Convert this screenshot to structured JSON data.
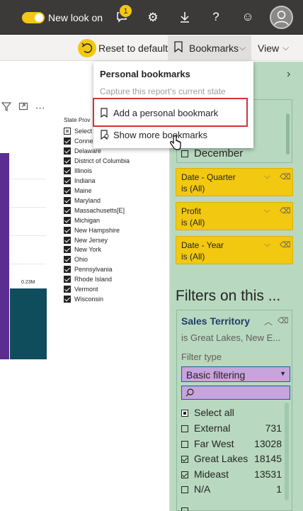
{
  "topbar": {
    "new_look_label": "New look on",
    "notification_count": "1",
    "icons": [
      "notification-icon",
      "gear-icon",
      "download-icon",
      "help-icon",
      "smiley-icon",
      "avatar-icon"
    ]
  },
  "toolbar": {
    "reset_label": "Reset to default",
    "bookmarks_label": "Bookmarks",
    "view_label": "View"
  },
  "bookmarks_menu": {
    "header": "Personal bookmarks",
    "subtitle": "Capture this report's current state",
    "add_label": "Add a personal bookmark",
    "show_more_label": "Show more bookmarks"
  },
  "slicer": {
    "title": "State Prov",
    "select_all": "Select",
    "items": [
      "Conne",
      "Delaware",
      "District of Columbia",
      "Illinois",
      "Indiana",
      "Maine",
      "Maryland",
      "Massachusetts[E]",
      "Michigan",
      "New Hampshire",
      "New Jersey",
      "New York",
      "Ohio",
      "Pennsylvania",
      "Rhode Island",
      "Vermont",
      "Wisconsin"
    ]
  },
  "chart": {
    "bar_label": "0.23M"
  },
  "filters": {
    "top_item": "December",
    "cards": [
      {
        "title": "Date - Quarter",
        "value": "is (All)"
      },
      {
        "title": "Profit",
        "value": "is (All)"
      },
      {
        "title": "Date - Year",
        "value": "is (All)"
      }
    ],
    "section_title": "Filters on this ...",
    "sales": {
      "title": "Sales Territory",
      "summary": "is Great Lakes, New E...",
      "filter_type_label": "Filter type",
      "filter_type_value": "Basic filtering",
      "select_all": "Select all",
      "items": [
        {
          "name": "External",
          "count": "731",
          "checked": false
        },
        {
          "name": "Far West",
          "count": "13028",
          "checked": false
        },
        {
          "name": "Great Lakes",
          "count": "18145",
          "checked": true
        },
        {
          "name": "Mideast",
          "count": "13531",
          "checked": true
        },
        {
          "name": "N/A",
          "count": "1",
          "checked": false
        }
      ]
    }
  },
  "colors": {
    "topbar": "#3b3a39",
    "accent": "#f2c811",
    "filter_pane": "#b8d9c0",
    "purple_bar": "#5c2d91",
    "teal_bar": "#0f4c5c",
    "highlight_red": "#d13438",
    "filter_type_select": "#c6a4dc"
  }
}
